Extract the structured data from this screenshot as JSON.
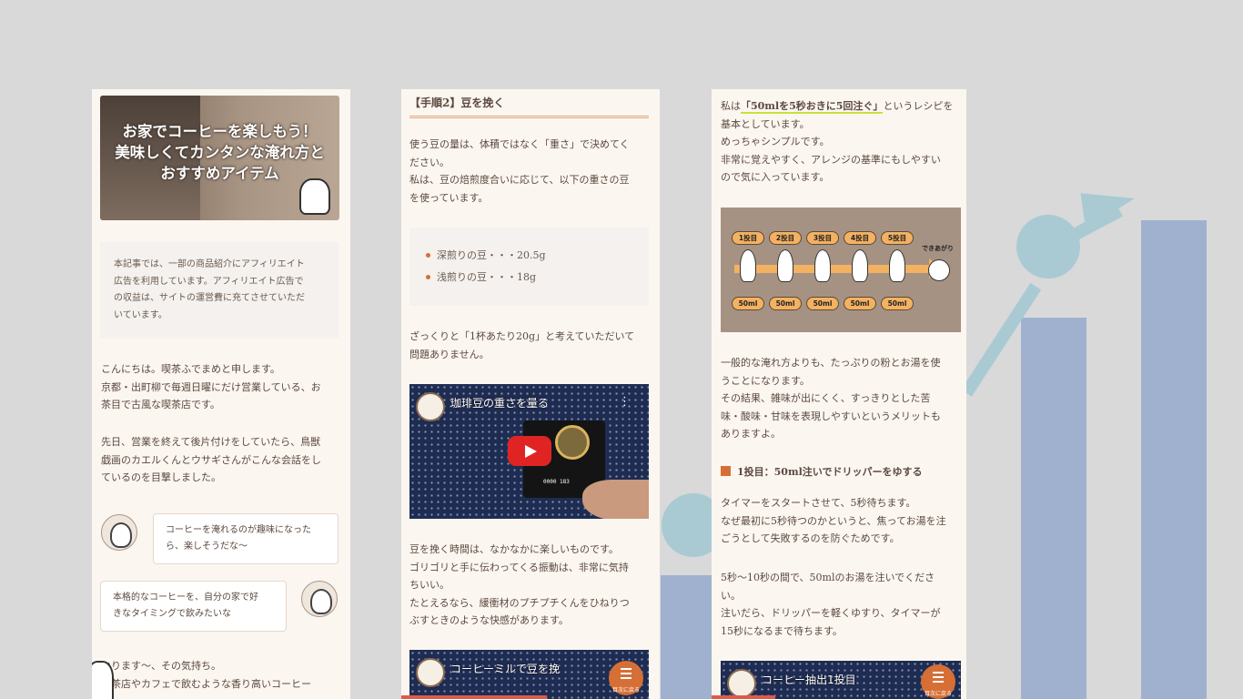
{
  "colors": {
    "accent": "#d66f36",
    "panel_bg": "#fcf6f1",
    "box_bg": "#f4f1ee",
    "highlight": "#c6e33a",
    "bg_bar": "#9fb1ce",
    "bg_teal": "#a9cad3"
  },
  "panel1": {
    "hero_title_line1": "お家でコーヒーを楽しもう！",
    "hero_title_line2": "美味しくてカンタンな淹れ方と",
    "hero_title_line3": "おすすめアイテム",
    "notice_lines": [
      "本記事では、一部の商品紹介にアフィリエイト",
      "広告を利用しています。アフィリエイト広告で",
      "の収益は、サイトの運営費に充てさせていただ",
      "いています。"
    ],
    "intro_lines": [
      "こんにちは。喫茶ふでまめと申します。",
      "京都・出町柳で毎週日曜にだけ営業している、お",
      "茶目で古風な喫茶店です。"
    ],
    "story_lines": [
      "先日、営業を終えて後片付けをしていたら、鳥獣",
      "戯画のカエルくんとウサギさんがこんな会話をし",
      "ているのを目撃しました。"
    ],
    "bubble1_lines": [
      "コーヒーを淹れるのが趣味になった",
      "ら、楽しそうだな〜"
    ],
    "bubble2_lines": [
      "本格的なコーヒーを、自分の家で好",
      "きなタイミングで飲みたいな"
    ],
    "closing_lines": [
      "かります〜、その気持ち。",
      "喫茶店やカフェで飲むような香り高いコーヒー"
    ]
  },
  "panel2": {
    "heading": "【手順2】豆を挽く",
    "p1_lines": [
      "使う豆の量は、体積ではなく「重さ」で決めてく",
      "ださい。",
      "私は、豆の焙煎度合いに応じて、以下の重さの豆",
      "を使っています。"
    ],
    "list": [
      "深煎りの豆・・・20.5g",
      "浅煎りの豆・・・18g"
    ],
    "p2_lines": [
      "ざっくりと「1杯あたり20g」と考えていただいて",
      "問題ありません。"
    ],
    "video1_title": "珈琲豆の重さを量る",
    "video1_menu": "⋮",
    "p3_lines": [
      "豆を挽く時間は、なかなかに楽しいものです。",
      "ゴリゴリと手に伝わってくる振動は、非常に気持",
      "ちいい。",
      "たとえるなら、緩衝材のプチプチくんをひねりつ",
      "ぶすときのような快感があります。"
    ],
    "video2_title": "コーヒーミルで豆を挽",
    "toc_label": "目次に戻る"
  },
  "panel3": {
    "p1_pre": "私は",
    "p1_highlight": "「50mlを5秒おきに5回注ぐ」",
    "p1_post": "というレシピを",
    "p1_rest": [
      "基本としています。",
      "めっちゃシンプルです。",
      "非常に覚えやすく、アレンジの基準にもしやすい",
      "ので気に入っています。"
    ],
    "recipe_steps": [
      "1投目",
      "2投目",
      "3投目",
      "4投目",
      "5投目"
    ],
    "recipe_amounts": [
      "50ml",
      "50ml",
      "50ml",
      "50ml",
      "50ml"
    ],
    "recipe_done": "できあがり",
    "p2_lines": [
      "一般的な淹れ方よりも、たっぷりの粉とお湯を使",
      "うことになります。",
      "その結果、雑味が出にくく、すっきりとした苦",
      "味・酸味・甘味を表現しやすいというメリットも",
      "ありますよ。"
    ],
    "heading": "1投目：50ml注いでドリッパーをゆする",
    "p3_lines": [
      "タイマーをスタートさせて、5秒待ちます。",
      "なぜ最初に5秒待つのかというと、焦ってお湯を注",
      "ごうとして失敗するのを防ぐためです。"
    ],
    "p4_lines": [
      "5秒〜10秒の間で、50mlのお湯を注いでくださ",
      "い。",
      "注いだら、ドリッパーを軽くゆすり、タイマーが",
      "15秒になるまで待ちます。"
    ],
    "video_title": "コーヒー抽出1投目",
    "toc_label": "目次に戻る"
  }
}
